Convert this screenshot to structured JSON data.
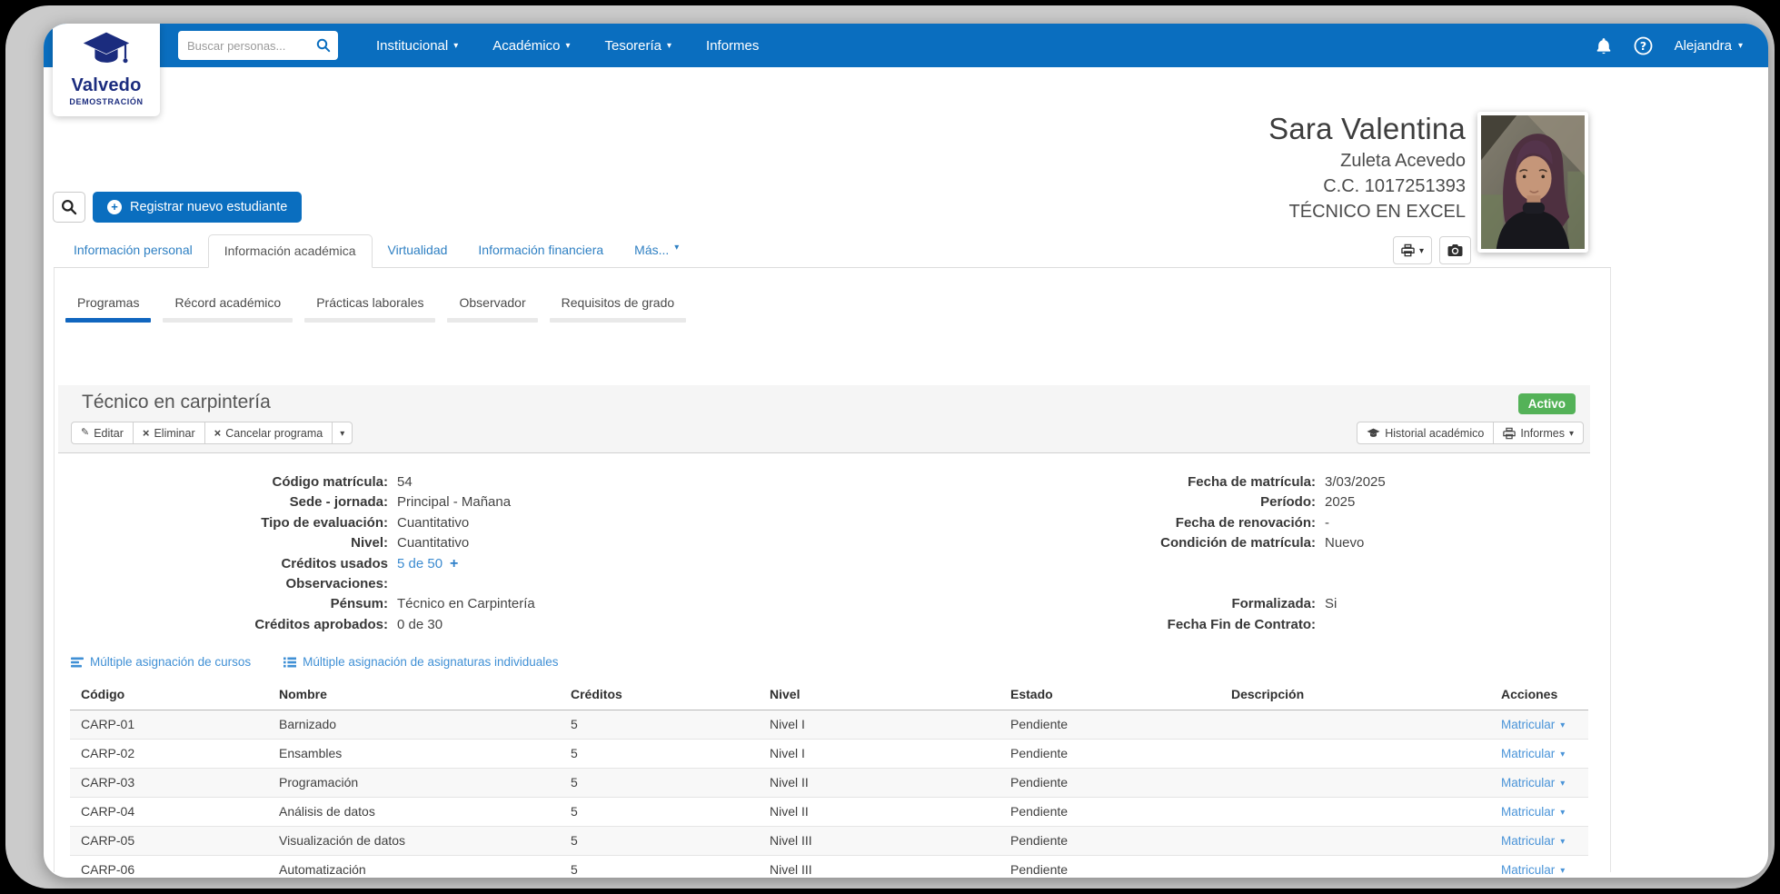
{
  "icons": {
    "caret": "▾",
    "plus": "+",
    "close": "×",
    "pencil": "✎",
    "question": "?"
  },
  "logo": {
    "name": "Valvedo",
    "subtitle": "DEMOSTRACIÓN"
  },
  "topbar": {
    "search_placeholder": "Buscar personas...",
    "menu": [
      {
        "label": "Institucional"
      },
      {
        "label": "Académico"
      },
      {
        "label": "Tesorería"
      },
      {
        "label": "Informes"
      }
    ],
    "user": "Alejandra"
  },
  "student": {
    "first_names": "Sara Valentina",
    "last_names": "Zuleta Acevedo",
    "document": "C.C. 1017251393",
    "program_label": "TÉCNICO EN EXCEL"
  },
  "actions": {
    "register": "Registrar nuevo estudiante"
  },
  "tabs": {
    "items": [
      {
        "label": "Información personal"
      },
      {
        "label": "Información académica"
      },
      {
        "label": "Virtualidad"
      },
      {
        "label": "Información financiera"
      },
      {
        "label": "Más..."
      }
    ],
    "active": "Información académica"
  },
  "subtabs": {
    "items": [
      {
        "label": "Programas"
      },
      {
        "label": "Récord académico"
      },
      {
        "label": "Prácticas laborales"
      },
      {
        "label": "Observador"
      },
      {
        "label": "Requisitos de grado"
      }
    ],
    "active": "Programas"
  },
  "program": {
    "title": "Técnico en carpintería",
    "status_badge": "Activo",
    "toolbar": {
      "edit": "Editar",
      "delete": "Eliminar",
      "cancel": "Cancelar programa",
      "history": "Historial académico",
      "reports": "Informes"
    },
    "details_left": [
      {
        "label": "Código matrícula:",
        "value": "54"
      },
      {
        "label": "Sede - jornada:",
        "value": "Principal - Mañana"
      },
      {
        "label": "Tipo de evaluación:",
        "value": "Cuantitativo"
      },
      {
        "label": "Nivel:",
        "value": "Cuantitativo"
      },
      {
        "label": "Créditos usados",
        "value": "5 de 50"
      },
      {
        "label": "Observaciones:",
        "value": ""
      },
      {
        "label": "Pénsum:",
        "value": "Técnico en Carpintería"
      },
      {
        "label": "Créditos aprobados:",
        "value": "0 de 30"
      }
    ],
    "details_right": [
      {
        "label": "Fecha de matrícula:",
        "value": "3/03/2025"
      },
      {
        "label": "Período:",
        "value": "2025"
      },
      {
        "label": "Fecha de renovación:",
        "value": "-"
      },
      {
        "label": "Condición de matrícula:",
        "value": "Nuevo"
      },
      {
        "label": "",
        "value": ""
      },
      {
        "label": "",
        "value": ""
      },
      {
        "label": "Formalizada:",
        "value": "Si"
      },
      {
        "label": "Fecha Fin de Contrato:",
        "value": ""
      }
    ]
  },
  "assignment_links": {
    "courses": "Múltiple asignación de cursos",
    "subjects": "Múltiple asignación de asignaturas individuales"
  },
  "table": {
    "columns": [
      "Código",
      "Nombre",
      "Créditos",
      "Nivel",
      "Estado",
      "Descripción",
      "Acciones"
    ],
    "action_label": "Matricular",
    "rows": [
      {
        "codigo": "CARP-01",
        "nombre": "Barnizado",
        "creditos": "5",
        "nivel": "Nivel I",
        "estado": "Pendiente",
        "descripcion": ""
      },
      {
        "codigo": "CARP-02",
        "nombre": "Ensambles",
        "creditos": "5",
        "nivel": "Nivel I",
        "estado": "Pendiente",
        "descripcion": ""
      },
      {
        "codigo": "CARP-03",
        "nombre": "Programación",
        "creditos": "5",
        "nivel": "Nivel II",
        "estado": "Pendiente",
        "descripcion": ""
      },
      {
        "codigo": "CARP-04",
        "nombre": "Análisis de datos",
        "creditos": "5",
        "nivel": "Nivel II",
        "estado": "Pendiente",
        "descripcion": ""
      },
      {
        "codigo": "CARP-05",
        "nombre": "Visualización de datos",
        "creditos": "5",
        "nivel": "Nivel III",
        "estado": "Pendiente",
        "descripcion": ""
      },
      {
        "codigo": "CARP-06",
        "nombre": "Automatización",
        "creditos": "5",
        "nivel": "Nivel III",
        "estado": "Pendiente",
        "descripcion": ""
      }
    ]
  },
  "colors": {
    "navbar_blue": "#0a6ebf",
    "link_blue": "#4090d5",
    "badge_green": "#54b258",
    "active_underline": "#1166bf"
  }
}
